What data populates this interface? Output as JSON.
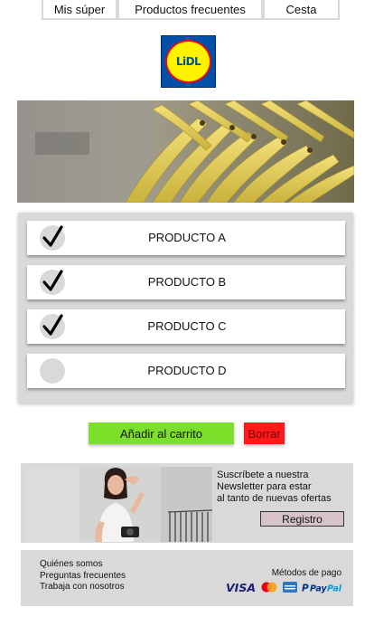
{
  "nav": {
    "tabs": [
      "Mis súper",
      "Productos frecuentes",
      "Cesta"
    ]
  },
  "logo": {
    "text": "LiDL"
  },
  "products": [
    {
      "label": "PRODUCTO A",
      "checked": true
    },
    {
      "label": "PRODUCTO B",
      "checked": true
    },
    {
      "label": "PRODUCTO C",
      "checked": true
    },
    {
      "label": "PRODUCTO D",
      "checked": false
    }
  ],
  "actions": {
    "add_label": "Añadir al carrito",
    "delete_label": "Borrar"
  },
  "newsletter": {
    "line1": "Suscríbete a nuestra",
    "line2": "Newsletter para estar",
    "line3": "al tanto de nuevas ofertas",
    "button": "Registro"
  },
  "footer": {
    "links": [
      "Quiénes somos",
      "Preguntas frecuentes",
      "Trabaja con nosotros"
    ],
    "payment_title": "Métodos de pago",
    "payment_icons": [
      "visa-icon",
      "mastercard-icon",
      "amex-icon",
      "paypal-icon"
    ]
  },
  "colors": {
    "add_button": "#7ce02a",
    "delete_button": "#ff1a1a",
    "panel": "#d9d9d9",
    "lidl_blue": "#0050aa",
    "lidl_yellow": "#fff200",
    "lidl_red": "#e60a14"
  }
}
